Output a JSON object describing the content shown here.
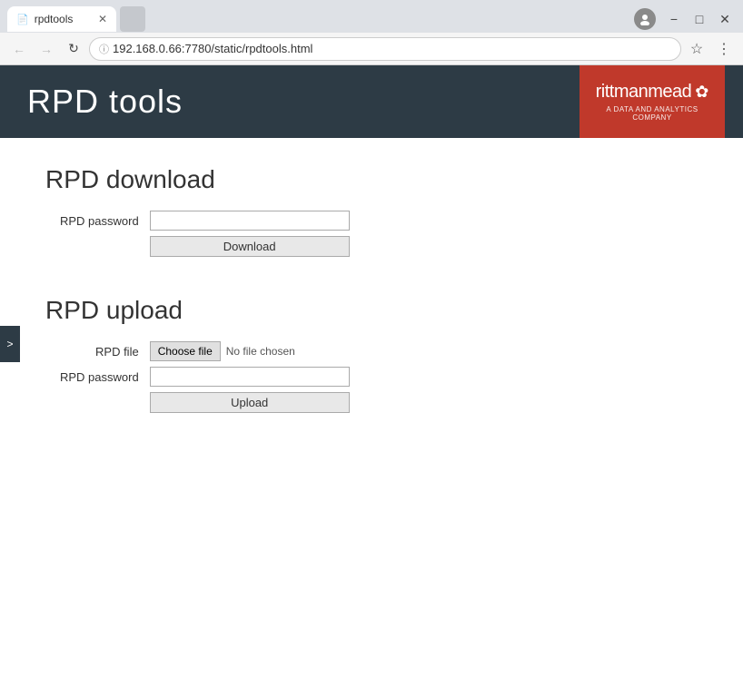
{
  "browser": {
    "tab_title": "rpdtools",
    "tab_icon": "📄",
    "address": "192.168.0.66:7780/static/rpdtools.html",
    "address_prefix": "192.168.0.66",
    "address_suffix": ":7780/static/rpdtools.html",
    "new_tab_placeholder": ""
  },
  "header": {
    "page_title": "RPD tools",
    "brand_name_bold": "rittman",
    "brand_name_light": "mead",
    "brand_sub": "A DATA AND ANALYTICS COMPANY",
    "brand_icon": "⚙"
  },
  "sidebar": {
    "toggle_label": ">"
  },
  "download_section": {
    "title": "RPD download",
    "password_label": "RPD password",
    "download_button": "Download"
  },
  "upload_section": {
    "title": "RPD upload",
    "file_label": "RPD file",
    "choose_file_btn": "Choose file",
    "no_file_text": "No file chosen",
    "password_label": "RPD password",
    "upload_button": "Upload"
  }
}
